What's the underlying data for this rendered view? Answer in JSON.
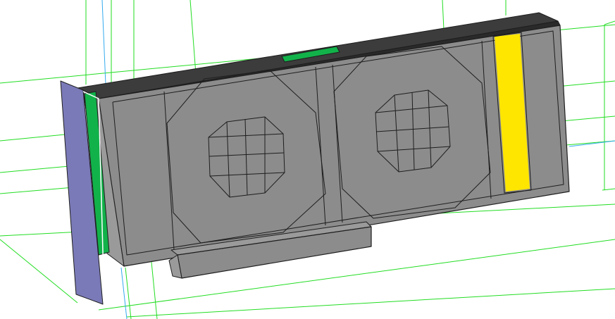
{
  "viewport": {
    "background": "#ffffff",
    "grid_color": "#22dd22",
    "axis_color": "#33aaee"
  },
  "model": {
    "body_color": "#8c8c8c",
    "body_light": "#9a9a9a",
    "edge_color": "#1e1e1e",
    "top_color": "#3c3c3c",
    "bracket_color": "#7b7ab8",
    "bracket_edge": "#ffffff",
    "green_accent": "#12b24a",
    "yellow_accent": "#ffe600"
  }
}
